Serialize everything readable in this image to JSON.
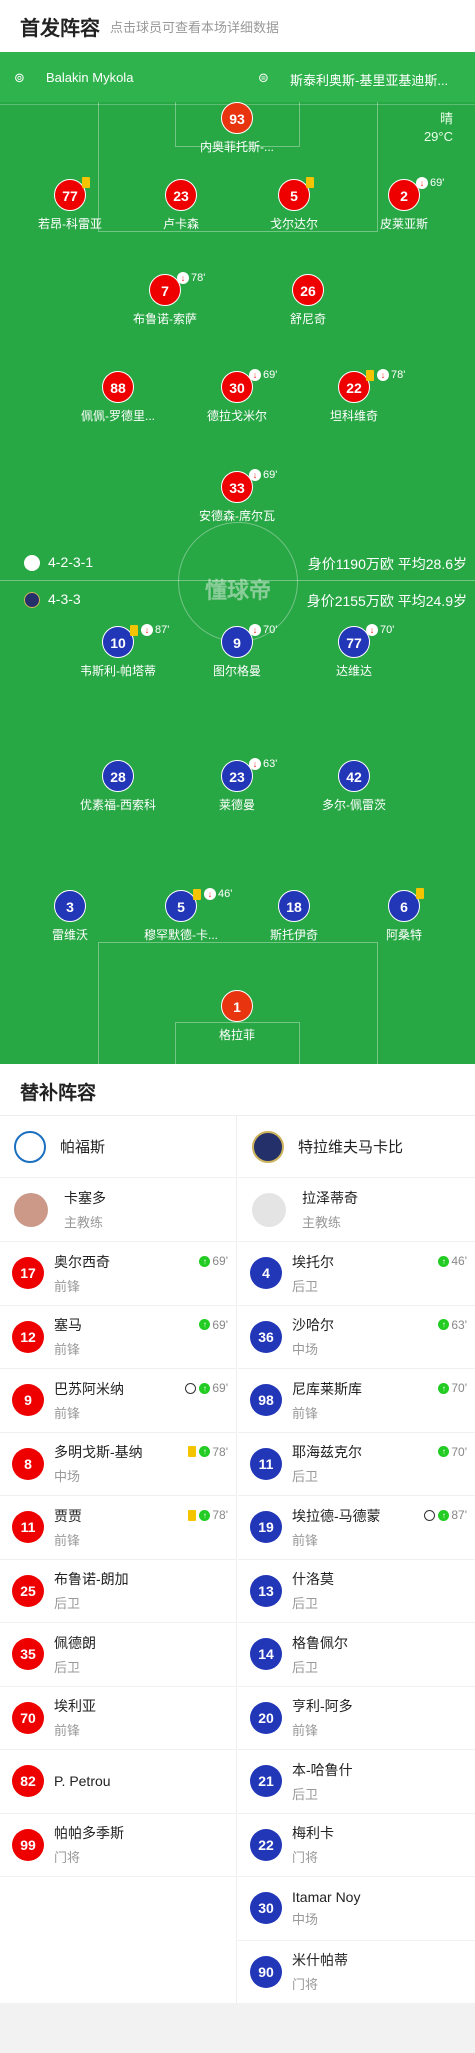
{
  "header": {
    "title": "首发阵容",
    "subtitle": "点击球员可查看本场详细数据"
  },
  "teambar": {
    "home_name": "Balakin Mykola",
    "away_name": "斯泰利奥斯-基里亚基迪斯..."
  },
  "weather": {
    "condition": "晴",
    "temp": "29°C"
  },
  "home": {
    "formation": "4-2-3-1",
    "value": "身价1190万欧 平均28.6岁",
    "players": [
      {
        "num": "93",
        "name": "内奥菲托斯-...",
        "gk": true
      },
      {
        "num": "77",
        "name": "若昂-科雷亚",
        "yellow": true
      },
      {
        "num": "23",
        "name": "卢卡森"
      },
      {
        "num": "5",
        "name": "戈尔达尔",
        "yellow": true
      },
      {
        "num": "2",
        "name": "皮莱亚斯",
        "off": "69'"
      },
      {
        "num": "7",
        "name": "布鲁诺-索萨",
        "off": "78'"
      },
      {
        "num": "26",
        "name": "舒尼奇"
      },
      {
        "num": "88",
        "name": "佩佩-罗德里..."
      },
      {
        "num": "30",
        "name": "德拉戈米尔",
        "off": "69'"
      },
      {
        "num": "22",
        "name": "坦科维奇",
        "yellow": true,
        "off": "78'",
        "captain": true
      },
      {
        "num": "33",
        "name": "安德森-席尔瓦",
        "off": "69'"
      }
    ]
  },
  "away": {
    "formation": "4-3-3",
    "value": "身价2155万欧 平均24.9岁",
    "players": [
      {
        "num": "10",
        "name": "韦斯利-帕塔蒂",
        "yellow": true,
        "off": "87'"
      },
      {
        "num": "9",
        "name": "图尔格曼",
        "off": "70'"
      },
      {
        "num": "77",
        "name": "达维达",
        "off": "70'"
      },
      {
        "num": "28",
        "name": "优素福-西索科"
      },
      {
        "num": "23",
        "name": "莱德曼",
        "off": "63'"
      },
      {
        "num": "42",
        "name": "多尔-佩雷茨",
        "captain": true
      },
      {
        "num": "3",
        "name": "雷维沃",
        "goal": true
      },
      {
        "num": "5",
        "name": "穆罕默德-卡...",
        "yellow": true,
        "off": "46'"
      },
      {
        "num": "18",
        "name": "斯托伊奇"
      },
      {
        "num": "6",
        "name": "阿桑特",
        "yellow": true
      },
      {
        "num": "1",
        "name": "格拉菲",
        "gk": true
      }
    ]
  },
  "bench": {
    "title": "替补阵容",
    "coach_label": "主教练",
    "home": {
      "team": "帕福斯",
      "coach": "卡塞多",
      "subs": [
        {
          "num": "17",
          "name": "奥尔西奇",
          "pos": "前锋",
          "in": "69'"
        },
        {
          "num": "12",
          "name": "塞马",
          "pos": "前锋",
          "in": "69'"
        },
        {
          "num": "9",
          "name": "巴苏阿米纳",
          "pos": "前锋",
          "in": "69'",
          "goal": true
        },
        {
          "num": "8",
          "name": "多明戈斯-基纳",
          "pos": "中场",
          "in": "78'",
          "yellow": true
        },
        {
          "num": "11",
          "name": "贾贾",
          "pos": "前锋",
          "in": "78'",
          "yellow": true
        },
        {
          "num": "25",
          "name": "布鲁诺-朗加",
          "pos": "后卫"
        },
        {
          "num": "35",
          "name": "佩德朗",
          "pos": "后卫"
        },
        {
          "num": "70",
          "name": "埃利亚",
          "pos": "前锋"
        },
        {
          "num": "82",
          "name": "P. Petrou",
          "pos": ""
        },
        {
          "num": "99",
          "name": "帕帕多季斯",
          "pos": "门将"
        }
      ]
    },
    "away": {
      "team": "特拉维夫马卡比",
      "coach": "拉泽蒂奇",
      "subs": [
        {
          "num": "4",
          "name": "埃托尔",
          "pos": "后卫",
          "in": "46'"
        },
        {
          "num": "36",
          "name": "沙哈尔",
          "pos": "中场",
          "in": "63'"
        },
        {
          "num": "98",
          "name": "尼库莱斯库",
          "pos": "前锋",
          "in": "70'"
        },
        {
          "num": "11",
          "name": "耶海兹克尔",
          "pos": "后卫",
          "in": "70'"
        },
        {
          "num": "19",
          "name": "埃拉德-马德蒙",
          "pos": "前锋",
          "in": "87'",
          "goal": true
        },
        {
          "num": "13",
          "name": "什洛莫",
          "pos": "后卫"
        },
        {
          "num": "14",
          "name": "格鲁佩尔",
          "pos": "后卫"
        },
        {
          "num": "20",
          "name": "亨利-阿多",
          "pos": "前锋"
        },
        {
          "num": "21",
          "name": "本-哈鲁什",
          "pos": "后卫"
        },
        {
          "num": "22",
          "name": "梅利卡",
          "pos": "门将"
        },
        {
          "num": "30",
          "name": "Itamar Noy",
          "pos": "中场"
        },
        {
          "num": "90",
          "name": "米什帕蒂",
          "pos": "门将"
        }
      ]
    }
  },
  "watermark": "懂球帝",
  "colors": {
    "pitch": "#28a745",
    "home": "#e00000",
    "away": "#2236b8",
    "gk": "#e8340f",
    "yellow": "#f5c400"
  }
}
